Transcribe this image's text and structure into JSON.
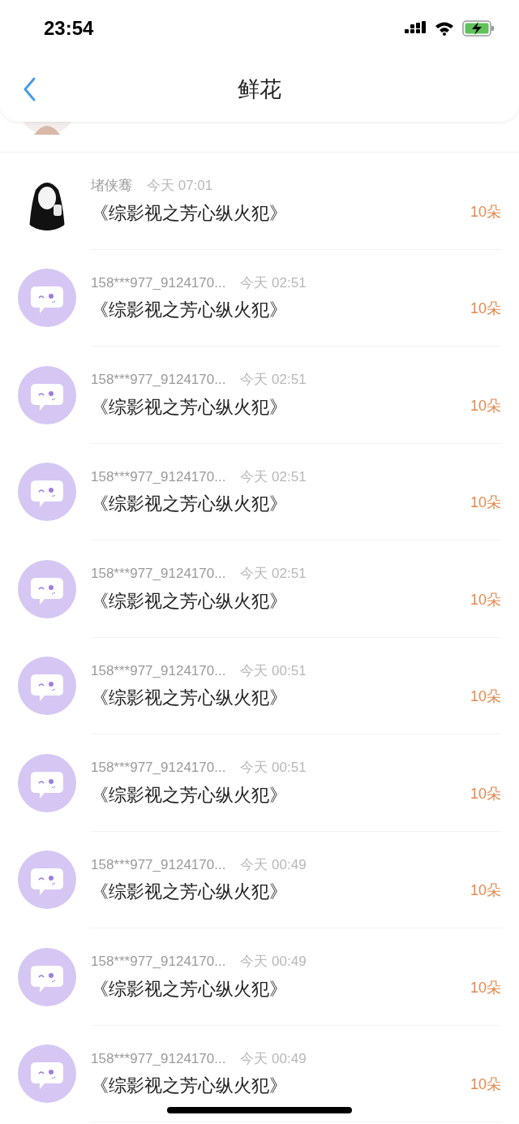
{
  "status_bar": {
    "time": "23:54"
  },
  "nav": {
    "title": "鲜花"
  },
  "rows": [
    {
      "kind": "picture",
      "name": "堵侠骞",
      "time": "今天 07:01",
      "title": "《综影视之芳心纵火犯》",
      "amount": "10朵"
    },
    {
      "kind": "icon",
      "name": "158***977_9124170...",
      "time": "今天 02:51",
      "title": "《综影视之芳心纵火犯》",
      "amount": "10朵"
    },
    {
      "kind": "icon",
      "name": "158***977_9124170...",
      "time": "今天 02:51",
      "title": "《综影视之芳心纵火犯》",
      "amount": "10朵"
    },
    {
      "kind": "icon",
      "name": "158***977_9124170...",
      "time": "今天 02:51",
      "title": "《综影视之芳心纵火犯》",
      "amount": "10朵"
    },
    {
      "kind": "icon",
      "name": "158***977_9124170...",
      "time": "今天 02:51",
      "title": "《综影视之芳心纵火犯》",
      "amount": "10朵"
    },
    {
      "kind": "icon",
      "name": "158***977_9124170...",
      "time": "今天 00:51",
      "title": "《综影视之芳心纵火犯》",
      "amount": "10朵"
    },
    {
      "kind": "icon",
      "name": "158***977_9124170...",
      "time": "今天 00:51",
      "title": "《综影视之芳心纵火犯》",
      "amount": "10朵"
    },
    {
      "kind": "icon",
      "name": "158***977_9124170...",
      "time": "今天 00:49",
      "title": "《综影视之芳心纵火犯》",
      "amount": "10朵"
    },
    {
      "kind": "icon",
      "name": "158***977_9124170...",
      "time": "今天 00:49",
      "title": "《综影视之芳心纵火犯》",
      "amount": "10朵"
    },
    {
      "kind": "icon",
      "name": "158***977_9124170...",
      "time": "今天 00:49",
      "title": "《综影视之芳心纵火犯》",
      "amount": "10朵"
    }
  ]
}
